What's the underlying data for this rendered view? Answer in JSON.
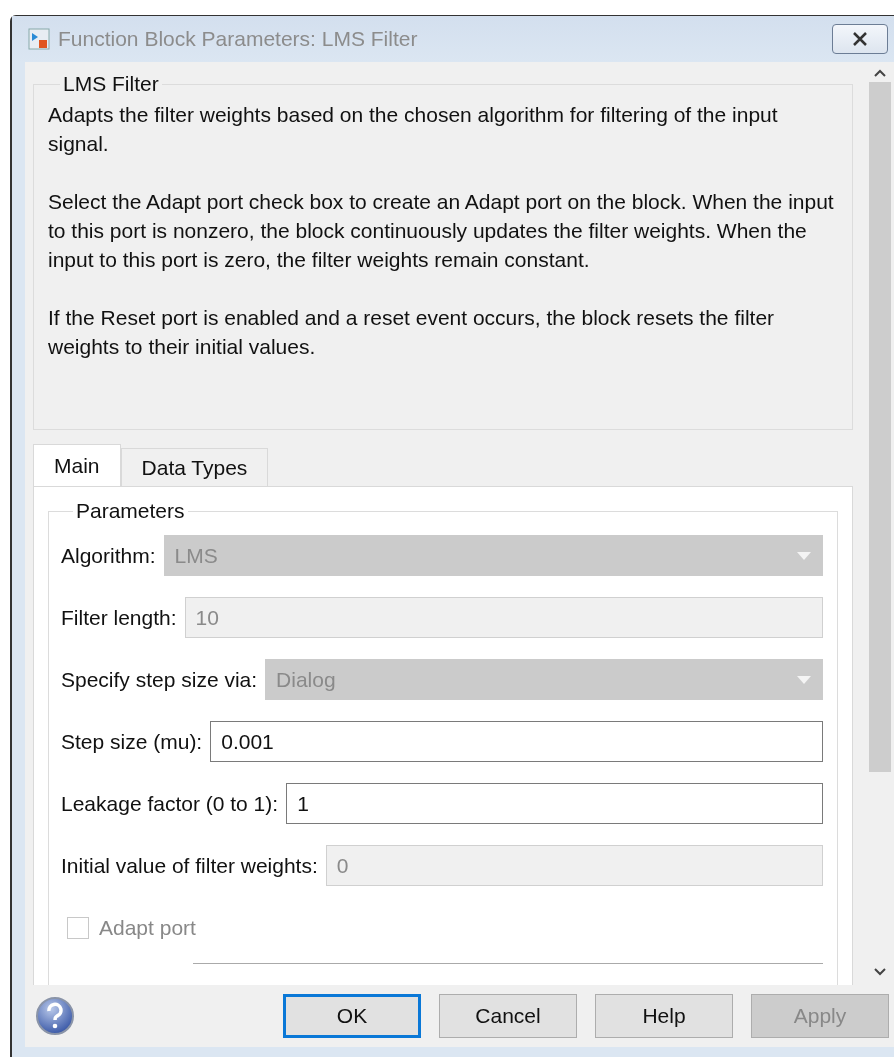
{
  "window": {
    "title": "Function Block Parameters: LMS Filter"
  },
  "description": {
    "title": "LMS Filter",
    "paragraphs": [
      "Adapts the filter weights based on the chosen algorithm for filtering of the input signal.",
      "Select the Adapt port check box to create an Adapt port on the block. When the input to this port is nonzero, the block continuously updates the filter weights. When the input to this port is zero, the filter weights remain constant.",
      "If the Reset port is enabled and a reset event occurs, the block resets the filter weights to their initial values."
    ]
  },
  "tabs": [
    {
      "label": "Main",
      "selected": true
    },
    {
      "label": "Data Types",
      "selected": false
    }
  ],
  "parameters": {
    "title": "Parameters",
    "rows": [
      {
        "kind": "dropdown",
        "label": "Algorithm:",
        "value": "LMS",
        "disabled": true
      },
      {
        "kind": "field",
        "label": "Filter length:",
        "value": "10",
        "disabled": true
      },
      {
        "kind": "dropdown",
        "label": "Specify step size via:",
        "value": "Dialog",
        "disabled": true
      },
      {
        "kind": "field",
        "label": "Step size (mu):",
        "value": "0.001",
        "disabled": false
      },
      {
        "kind": "field",
        "label": "Leakage factor (0 to 1):",
        "value": "1",
        "disabled": false
      },
      {
        "kind": "field",
        "label": "Initial value of filter weights:",
        "value": "0",
        "disabled": true
      },
      {
        "kind": "checkbox",
        "label": "Adapt port",
        "checked": false,
        "disabled": true
      }
    ]
  },
  "buttons": [
    {
      "label": "OK",
      "default": true,
      "disabled": false
    },
    {
      "label": "Cancel",
      "default": false,
      "disabled": false
    },
    {
      "label": "Help",
      "default": false,
      "disabled": false
    },
    {
      "label": "Apply",
      "default": false,
      "disabled": true
    }
  ]
}
